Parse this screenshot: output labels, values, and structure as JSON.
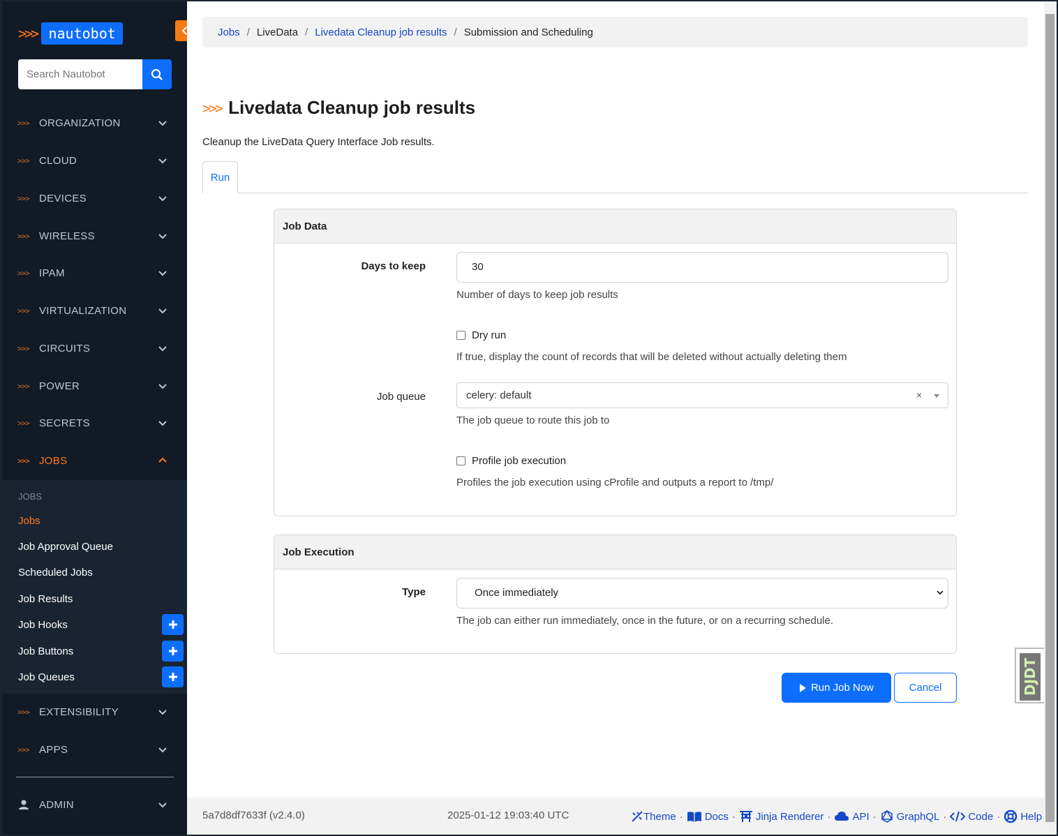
{
  "sidebar": {
    "logo_text": "nautobot",
    "search_placeholder": "Search Nautobot",
    "nav": [
      {
        "label": "ORGANIZATION"
      },
      {
        "label": "CLOUD"
      },
      {
        "label": "DEVICES"
      },
      {
        "label": "WIRELESS"
      },
      {
        "label": "IPAM"
      },
      {
        "label": "VIRTUALIZATION"
      },
      {
        "label": "CIRCUITS"
      },
      {
        "label": "POWER"
      },
      {
        "label": "SECRETS"
      },
      {
        "label": "JOBS"
      },
      {
        "label": "EXTENSIBILITY"
      },
      {
        "label": "APPS"
      },
      {
        "label": "ADMIN"
      }
    ],
    "jobs_section_header": "JOBS",
    "jobs_items": [
      "Jobs",
      "Job Approval Queue",
      "Scheduled Jobs",
      "Job Results",
      "Job Hooks",
      "Job Buttons",
      "Job Queues"
    ]
  },
  "breadcrumb": [
    "Jobs",
    "LiveData",
    "Livedata Cleanup job results",
    "Submission and Scheduling"
  ],
  "page": {
    "title": "Livedata Cleanup job results",
    "description": "Cleanup the LiveData Query Interface Job results.",
    "tab_run": "Run"
  },
  "job_data": {
    "heading": "Job Data",
    "days_label": "Days to keep",
    "days_value": "30",
    "days_help": "Number of days to keep job results",
    "dry_run_label": "Dry run",
    "dry_run_checked": false,
    "dry_run_help": "If true, display the count of records that will be deleted without actually deleting them",
    "queue_label": "Job queue",
    "queue_value": "celery: default",
    "queue_clear": "×",
    "queue_help": "The job queue to route this job to",
    "profile_label": "Profile job execution",
    "profile_checked": false,
    "profile_help": "Profiles the job execution using cProfile and outputs a report to /tmp/"
  },
  "job_execution": {
    "heading": "Job Execution",
    "type_label": "Type",
    "type_value": "Once immediately",
    "type_help": "The job can either run immediately, once in the future, or on a recurring schedule."
  },
  "actions": {
    "run": "Run Job Now",
    "cancel": "Cancel"
  },
  "footer": {
    "version": "5a7d8df7633f (v2.4.0)",
    "timestamp": "2025-01-12 19:03:40 UTC",
    "links": [
      "Theme",
      "Docs",
      "Jinja Renderer",
      "API",
      "GraphQL",
      "Code",
      "Help"
    ],
    "separator": "·"
  },
  "djdt": "DJDT",
  "colors": {
    "accent": "#0d6efd",
    "brand_orange": "#ff7a1a",
    "sidebar_bg": "#121a26"
  }
}
